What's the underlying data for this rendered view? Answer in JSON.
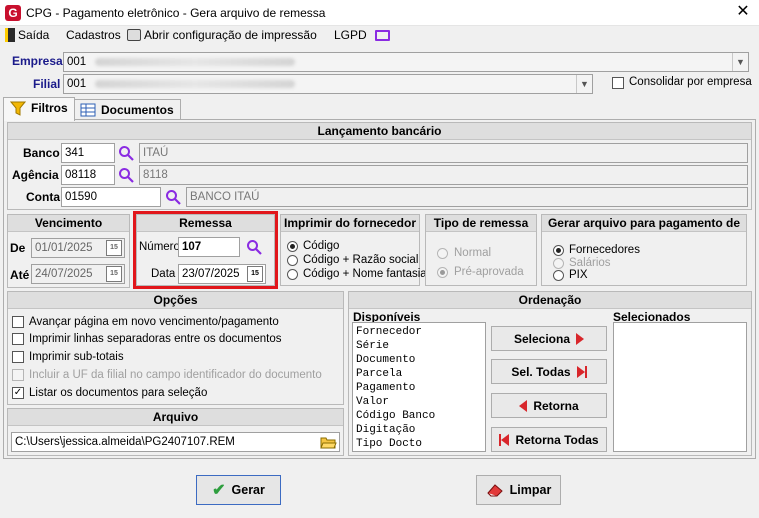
{
  "window": {
    "title": "CPG - Pagamento eletrônico - Gera arquivo de remessa",
    "app_icon_letter": "G"
  },
  "menu": {
    "exit": "Saída",
    "registers": "Cadastros",
    "print_config": "Abrir configuração de impressão",
    "lgpd": "LGPD"
  },
  "header": {
    "empresa_label": "Empresa",
    "empresa_value": "001",
    "filial_label": "Filial",
    "filial_value": "001",
    "consolidate_label": "Consolidar por empresa",
    "consolidate_checked": false
  },
  "tabs": [
    {
      "label": "Filtros",
      "active": true
    },
    {
      "label": "Documentos",
      "active": false
    }
  ],
  "bank_section": {
    "title": "Lançamento bancário",
    "banco_label": "Banco",
    "banco_code": "341",
    "banco_name": "ITAÚ",
    "agencia_label": "Agência",
    "agencia_code": "08118",
    "agencia_name": "8118",
    "conta_label": "Conta",
    "conta_code": "01590",
    "conta_name": "BANCO ITAÚ"
  },
  "vencimento": {
    "title": "Vencimento",
    "de_label": "De",
    "de_value": "01/01/2025",
    "ate_label": "Até",
    "ate_value": "24/07/2025"
  },
  "remessa": {
    "title": "Remessa",
    "numero_label": "Número",
    "numero_value": "107",
    "data_label": "Data",
    "data_value": "23/07/2025"
  },
  "imprimir_fornecedor": {
    "title": "Imprimir do fornecedor",
    "options": [
      "Código",
      "Código + Razão social",
      "Código + Nome fantasia"
    ],
    "selected": 0
  },
  "tipo_remessa": {
    "title": "Tipo de remessa",
    "options": [
      "Normal",
      "Pré-aprovada"
    ],
    "selected": 1
  },
  "gerar_arquivo": {
    "title": "Gerar arquivo para pagamento de",
    "options": [
      "Fornecedores",
      "Salários",
      "PIX"
    ],
    "selected": 0
  },
  "opcoes": {
    "title": "Opções",
    "items": [
      {
        "label": "Avançar página em novo vencimento/pagamento",
        "checked": false,
        "enabled": true
      },
      {
        "label": "Imprimir linhas separadoras entre os documentos",
        "checked": false,
        "enabled": true
      },
      {
        "label": "Imprimir sub-totais",
        "checked": false,
        "enabled": true
      },
      {
        "label": "Incluir a UF da filial no campo identificador do documento",
        "checked": false,
        "enabled": false
      },
      {
        "label": "Listar os documentos para seleção",
        "checked": true,
        "enabled": true
      }
    ]
  },
  "arquivo": {
    "title": "Arquivo",
    "path": "C:\\Users\\jessica.almeida\\PG2407107.REM"
  },
  "ordenacao": {
    "title": "Ordenação",
    "available_label": "Disponíveis",
    "selected_label": "Selecionados",
    "available": [
      "Fornecedor",
      "Série",
      "Documento",
      "Parcela",
      "Pagamento",
      "Valor",
      "Código Banco",
      "Digitação",
      "Tipo Docto"
    ],
    "selected": [],
    "btn_select": "Seleciona",
    "btn_select_all": "Sel. Todas",
    "btn_return": "Retorna",
    "btn_return_all": "Retorna Todas"
  },
  "actions": {
    "gerar": "Gerar",
    "limpar": "Limpar"
  },
  "colors": {
    "highlight": "#e1161b",
    "search_icon": "#8a2be2",
    "arrow_red": "#d8262b",
    "check_green": "#2e9e3e"
  }
}
